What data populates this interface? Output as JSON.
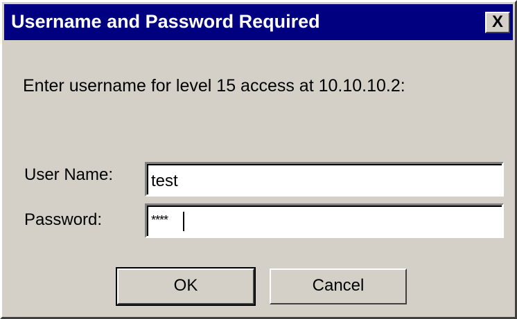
{
  "window": {
    "title": "Username and Password Required",
    "close_label": "X"
  },
  "prompt": "Enter username for level 15 access at 10.10.10.2:",
  "fields": {
    "username_label": "User Name:",
    "username_value": "test",
    "password_label": "Password:",
    "password_value": "****"
  },
  "buttons": {
    "ok_label": "OK",
    "cancel_label": "Cancel"
  },
  "colors": {
    "titlebar": "#000080",
    "face": "#d4d0c8"
  },
  "icons": {
    "close": "close-icon"
  }
}
